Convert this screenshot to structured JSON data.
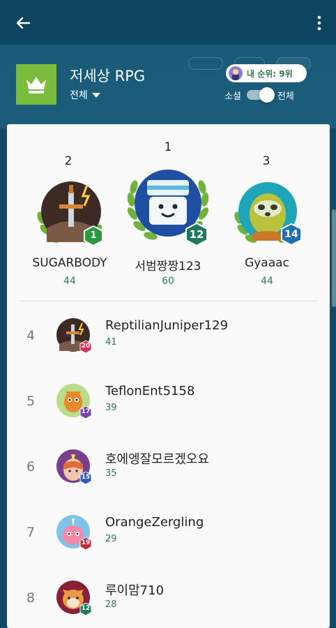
{
  "colors": {
    "header_bg": "#0f4a66",
    "accent_green": "#2e7d52",
    "game_icon_green": "#7cbc3b"
  },
  "toolbar": {
    "back_icon": "arrow-left-icon",
    "more_icon": "more-vertical-icon"
  },
  "game": {
    "title": "저세상 RPG",
    "scope_label": "전체",
    "icon": "crown-icon"
  },
  "my_rank": {
    "label": "내 순위: 9위"
  },
  "filter": {
    "social_label": "소셜",
    "all_label": "전체",
    "all_selected": true
  },
  "podium": [
    {
      "rank": "2",
      "name": "SUGARBODY",
      "score": "44",
      "level": "1",
      "badge_color": "#2a9a3f"
    },
    {
      "rank": "1",
      "name": "서범짱짱123",
      "score": "60",
      "level": "12",
      "badge_color": "#1d7a5f"
    },
    {
      "rank": "3",
      "name": "Gyaaac",
      "score": "44",
      "level": "14",
      "badge_color": "#1f6fb5"
    }
  ],
  "rows": [
    {
      "rank": "4",
      "name": "ReptilianJuniper129",
      "score": "41",
      "level": "20",
      "badge_color": "#d62f5a"
    },
    {
      "rank": "5",
      "name": "TeflonEnt5158",
      "score": "39",
      "level": "17",
      "badge_color": "#7b3fb5"
    },
    {
      "rank": "6",
      "name": "호에엥잘모르겠오요",
      "score": "35",
      "level": "15",
      "badge_color": "#2f58c0"
    },
    {
      "rank": "7",
      "name": "OrangeZergling",
      "score": "29",
      "level": "19",
      "badge_color": "#c02a3a"
    },
    {
      "rank": "8",
      "name": "루이맘710",
      "score": "28",
      "level": "12",
      "badge_color": "#1d7a5f"
    }
  ]
}
